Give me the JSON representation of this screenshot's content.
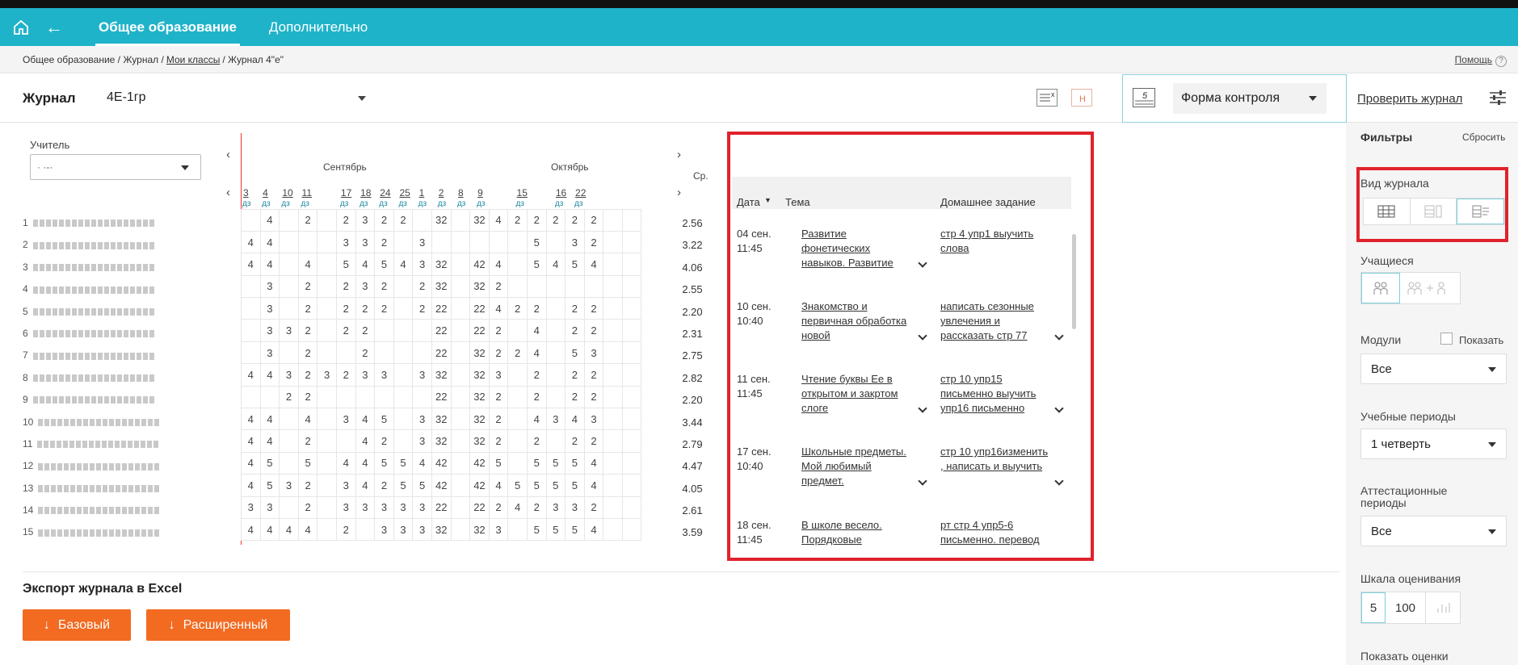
{
  "nav": {
    "tab_general": "Общее образование",
    "tab_extra": "Дополнительно"
  },
  "breadcrumb": {
    "p1": "Общее образование / Журнал /",
    "link": "Мои классы",
    "p3": "/ Журнал 4\"е\"",
    "help": "Помощь",
    "help_q": "?"
  },
  "toolbar": {
    "title": "Журнал",
    "group": "4Е-1гр",
    "control_form": "Форма контроля",
    "check": "Проверить журнал",
    "icon_mark": "Н",
    "icon_five": "5"
  },
  "grid": {
    "teacher_label": "Учитель",
    "teacher_value": "· ·-·",
    "months": [
      "Сентябрь",
      "Октябрь"
    ],
    "avg_label": "Ср.",
    "days": [
      "3",
      "4",
      "10",
      "11",
      "17",
      "18",
      "24",
      "25",
      "1",
      "2",
      "8",
      "9",
      "15",
      "16",
      "22"
    ],
    "dz": "дз",
    "num_prefixes": [
      "1",
      "2",
      "3",
      "4",
      "5",
      "6",
      "7",
      "8",
      "9",
      "10",
      "11",
      "12",
      "13",
      "14",
      "15"
    ],
    "rows": [
      [
        "",
        "4",
        "",
        "2",
        "",
        "2",
        "3",
        "2",
        "2",
        "",
        "32",
        "",
        "32",
        "4",
        "2",
        "2",
        "2",
        "2",
        "2",
        "",
        ""
      ],
      [
        "4",
        "4",
        "",
        "",
        "",
        "3",
        "3",
        "2",
        "",
        "3",
        "",
        "",
        "",
        "",
        "",
        "5",
        "",
        "3",
        "2",
        "",
        ""
      ],
      [
        "4",
        "4",
        "",
        "4",
        "",
        "5",
        "4",
        "5",
        "4",
        "3",
        "32",
        "",
        "42",
        "4",
        "",
        "5",
        "4",
        "5",
        "4",
        "",
        ""
      ],
      [
        "",
        "3",
        "",
        "2",
        "",
        "2",
        "3",
        "2",
        "",
        "2",
        "32",
        "",
        "32",
        "2",
        "",
        "",
        "",
        "",
        "",
        "",
        ""
      ],
      [
        "",
        "3",
        "",
        "2",
        "",
        "2",
        "2",
        "2",
        "",
        "2",
        "22",
        "",
        "22",
        "4",
        "2",
        "2",
        "",
        "2",
        "2",
        "",
        ""
      ],
      [
        "",
        "3",
        "3",
        "2",
        "",
        "2",
        "2",
        "",
        "",
        "",
        "22",
        "",
        "22",
        "2",
        "",
        "4",
        "",
        "2",
        "2",
        "",
        ""
      ],
      [
        "",
        "3",
        "",
        "2",
        "",
        "",
        "2",
        "",
        "",
        "",
        "22",
        "",
        "32",
        "2",
        "2",
        "4",
        "",
        "5",
        "3",
        "",
        ""
      ],
      [
        "4",
        "4",
        "3",
        "2",
        "3",
        "2",
        "3",
        "3",
        "",
        "3",
        "32",
        "",
        "32",
        "3",
        "",
        "2",
        "",
        "2",
        "2",
        "",
        ""
      ],
      [
        "",
        "",
        "2",
        "2",
        "",
        "",
        "",
        "",
        "",
        "",
        "22",
        "",
        "32",
        "2",
        "",
        "2",
        "",
        "2",
        "2",
        "",
        ""
      ],
      [
        "4",
        "4",
        "",
        "4",
        "",
        "3",
        "4",
        "5",
        "",
        "3",
        "32",
        "",
        "32",
        "2",
        "",
        "4",
        "3",
        "4",
        "3",
        "",
        ""
      ],
      [
        "4",
        "4",
        "",
        "2",
        "",
        "",
        "4",
        "2",
        "",
        "3",
        "32",
        "",
        "32",
        "2",
        "",
        "2",
        "",
        "2",
        "2",
        "",
        ""
      ],
      [
        "4",
        "5",
        "",
        "5",
        "",
        "4",
        "4",
        "5",
        "5",
        "4",
        "42",
        "",
        "42",
        "5",
        "",
        "5",
        "5",
        "5",
        "4",
        "",
        ""
      ],
      [
        "4",
        "5",
        "3",
        "2",
        "",
        "3",
        "4",
        "2",
        "5",
        "5",
        "42",
        "",
        "42",
        "4",
        "5",
        "5",
        "5",
        "5",
        "4",
        "",
        ""
      ],
      [
        "3",
        "3",
        "",
        "2",
        "",
        "3",
        "3",
        "3",
        "3",
        "3",
        "22",
        "",
        "22",
        "2",
        "4",
        "2",
        "3",
        "3",
        "2",
        "",
        ""
      ],
      [
        "4",
        "4",
        "4",
        "4",
        "",
        "2",
        "",
        "3",
        "3",
        "3",
        "32",
        "",
        "32",
        "3",
        "",
        "5",
        "5",
        "5",
        "4",
        "",
        ""
      ]
    ],
    "averages": [
      "2.56",
      "3.22",
      "4.06",
      "2.55",
      "2.20",
      "2.31",
      "2.75",
      "2.82",
      "2.20",
      "3.44",
      "2.79",
      "4.47",
      "4.05",
      "2.61",
      "3.59"
    ]
  },
  "lessons": {
    "col_date": "Дата",
    "col_topic": "Тема",
    "col_hw": "Домашнее задание",
    "items": [
      {
        "date": "04 сен.",
        "time": "11:45",
        "topic": "Развитие фонетических навыков. Развитие",
        "hw": "стр 4 упр1 выучить слова"
      },
      {
        "date": "10 сен.",
        "time": "10:40",
        "topic": "Знакомство и первичная обработка новой",
        "hw": "написать сезонные увлечения и рассказать стр 77"
      },
      {
        "date": "11 сен.",
        "time": "11:45",
        "topic": "Чтение буквы Ее в открытом и закртом слоге",
        "hw": "стр 10 упр15 письменно выучить упр16 письменно"
      },
      {
        "date": "17 сен.",
        "time": "10:40",
        "topic": "Школьные предметы. Мой любимый предмет.",
        "hw": "стр 10 упр16изменить , написать и выучить"
      },
      {
        "date": "18 сен.",
        "time": "11:45",
        "topic": "В школе весело. Порядковые",
        "hw": "рт стр 4 упр5-6 письменно. перевод"
      }
    ]
  },
  "export": {
    "title": "Экспорт журнала в Excel",
    "basic": "Базовый",
    "extended": "Расширенный",
    "dl_glyph": "↓"
  },
  "sidebar": {
    "filters": "Фильтры",
    "reset": "Сбросить",
    "view": "Вид журнала",
    "students": "Учащиеся",
    "modules": "Модули",
    "show": "Показать",
    "modules_value": "Все",
    "periods": "Учебные периоды",
    "periods_value": "1 четверть",
    "attest": "Аттестационные периоды",
    "attest_value": "Все",
    "scale": "Шкала оценивания",
    "scale_5": "5",
    "scale_100": "100",
    "show_marks": "Показать оценки"
  }
}
